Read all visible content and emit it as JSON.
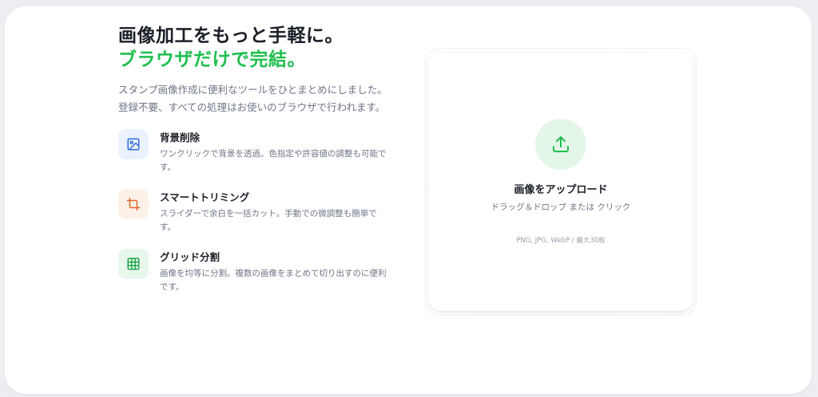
{
  "hero": {
    "title_line1": "画像加工をもっと手軽に。",
    "title_line2": "ブラウザだけで完結。",
    "description_line1": "スタンプ画像作成に便利なツールをひとまとめにしました。",
    "description_line2": "登録不要、すべての処理はお使いのブラウザで行われます。"
  },
  "features": [
    {
      "icon": "image-icon",
      "title": "背景削除",
      "description": "ワンクリックで背景を透過。色指定や許容値の調整も可能です。",
      "accent": "#2f6fe0",
      "bg": "#eaf2fd"
    },
    {
      "icon": "crop-icon",
      "title": "スマートトリミング",
      "description": "スライダーで余白を一括カット。手動での微調整も簡単です。",
      "accent": "#e0662a",
      "bg": "#fdf1e7"
    },
    {
      "icon": "grid-icon",
      "title": "グリッド分割",
      "description": "画像を均等に分割。複数の画像をまとめて切り出すのに便利です。",
      "accent": "#1fa84a",
      "bg": "#e8f7ec"
    }
  ],
  "upload": {
    "title": "画像をアップロード",
    "subtitle": "ドラッグ＆ドロップ または クリック",
    "formats": "PNG, JPG, WebP / 最大30枚",
    "icon": "upload-icon",
    "accent": "#1fbf4f"
  }
}
